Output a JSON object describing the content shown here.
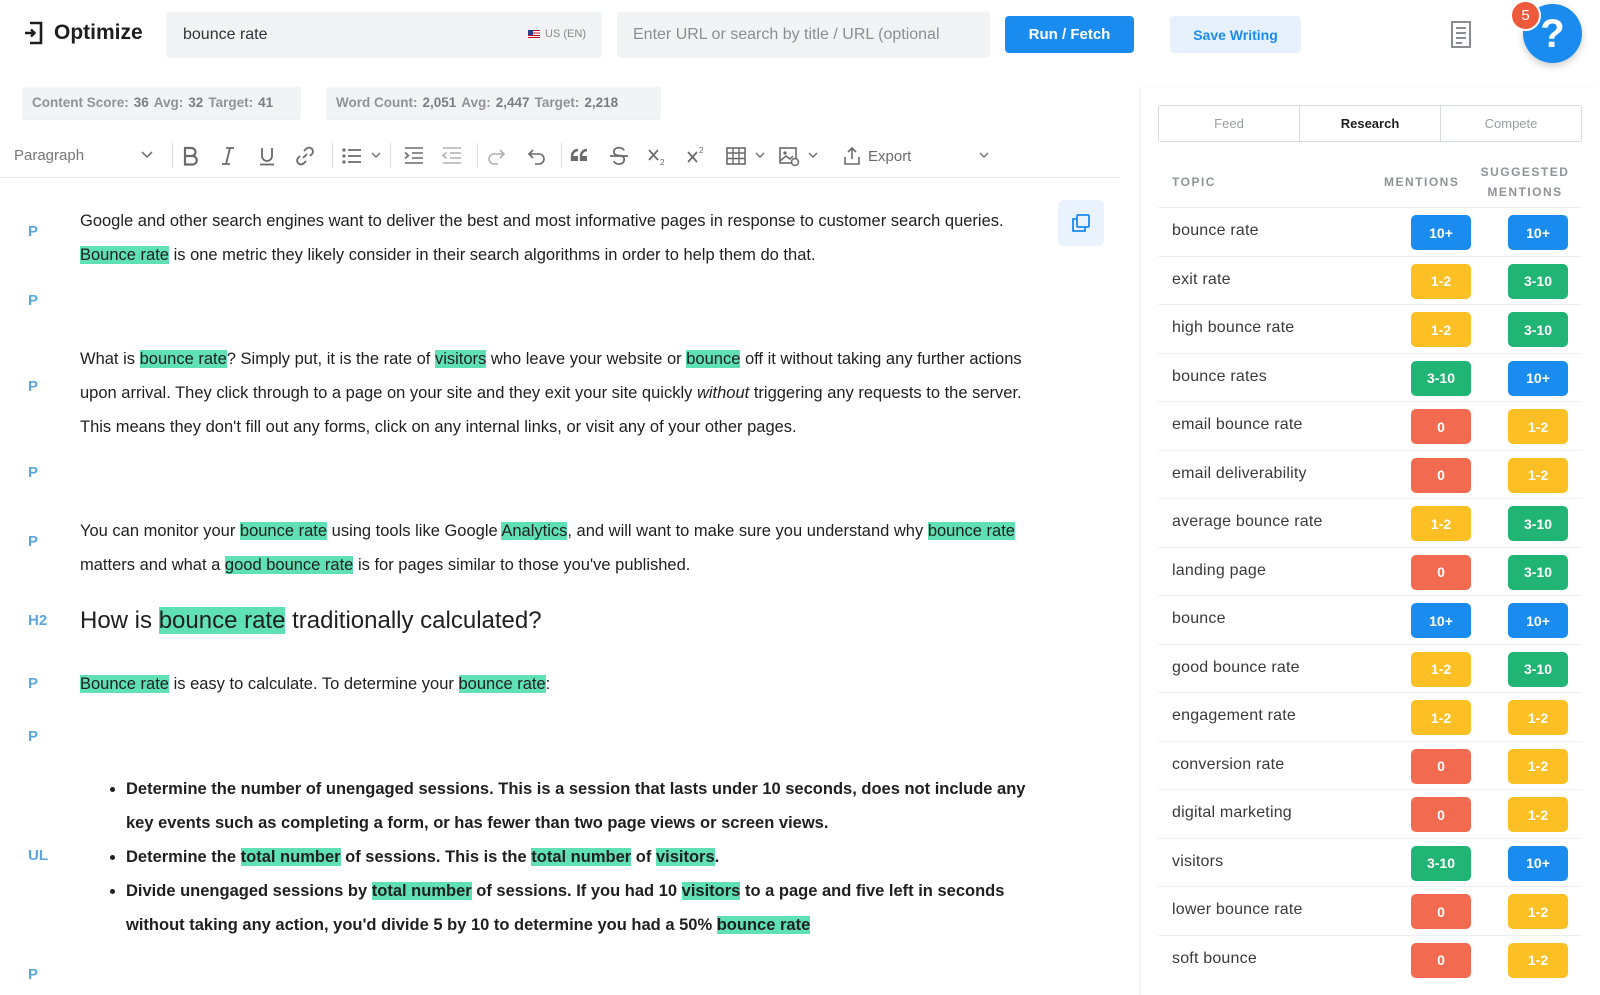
{
  "header": {
    "brand": "Optimize",
    "keyword": "bounce rate",
    "locale": "US (EN)",
    "url_placeholder": "Enter URL or search by title / URL (optional",
    "run_label": "Run / Fetch",
    "save_label": "Save Writing",
    "help_badge": "5",
    "help_symbol": "?"
  },
  "stats": {
    "score_label": "Content Score:",
    "score": "36",
    "score_avg_label": "Avg:",
    "score_avg": "32",
    "score_target_label": "Target:",
    "score_target": "41",
    "words_label": "Word Count:",
    "words": "2,051",
    "words_avg_label": "Avg:",
    "words_avg": "2,447",
    "words_target_label": "Target:",
    "words_target": "2,218"
  },
  "toolbar": {
    "paragraph": "Paragraph",
    "export": "Export"
  },
  "editor": {
    "tags": [
      "P",
      "P",
      "P",
      "P",
      "P",
      "H2",
      "P",
      "P",
      "UL",
      "P"
    ],
    "p1": [
      "Google and other search engines want to deliver the best and most informative pages in response to customer search queries. ",
      "Bounce rate",
      " is one metric they likely consider in their search algorithms in order to help them do that."
    ],
    "p2": [
      "What is ",
      "bounce rate",
      "? Simply put, it is the rate of ",
      "visitors",
      " who leave your website or ",
      "bounce",
      " off it without taking any further actions upon arrival. They click through to a page on your site and they exit your site quickly ",
      "without",
      " triggering any requests to the server. This means they don't fill out any forms, click on any internal links, or visit any of your other pages."
    ],
    "p3": [
      "You can monitor your ",
      "bounce rate",
      " using tools like Google ",
      "Analytics",
      ", and will want to make sure you understand why ",
      "bounce rate",
      " matters and what a ",
      "good bounce rate",
      " is for pages similar to those you've published."
    ],
    "h2": [
      "How is ",
      "bounce rate",
      " traditionally calculated?"
    ],
    "p4": [
      "Bounce rate",
      " is easy to calculate. To determine your ",
      "bounce rate",
      ":"
    ],
    "li1": "Determine the number of unengaged sessions. This is a session that lasts under 10 seconds, does not include any key events such as completing a form, or has fewer than two page views or screen views.",
    "li2": [
      "Determine the ",
      "total number",
      " of sessions. This is the ",
      "total number",
      " of ",
      "visitors",
      "."
    ],
    "li3": [
      "Divide unengaged sessions by ",
      "total number",
      " of sessions. If you had 10 ",
      "visitors",
      " to a page and five left in seconds without taking any action, you'd divide 5 by 10 to determine you had a 50% ",
      "bounce rate"
    ]
  },
  "panel": {
    "tabs": [
      "Feed",
      "Research",
      "Compete"
    ],
    "active_tab": "Research",
    "col_topic": "TOPIC",
    "col_mentions": "MENTIONS",
    "col_suggested": "SUGGESTED MENTIONS",
    "colors": {
      "blue": "#1a8cf0",
      "green": "#20b574",
      "yellow": "#fcbf24",
      "red": "#f26a4f"
    },
    "rows": [
      {
        "topic": "bounce rate",
        "mentions": "10+",
        "suggested": "10+"
      },
      {
        "topic": "exit rate",
        "mentions": "1-2",
        "suggested": "3-10"
      },
      {
        "topic": "high bounce rate",
        "mentions": "1-2",
        "suggested": "3-10"
      },
      {
        "topic": "bounce rates",
        "mentions": "3-10",
        "suggested": "10+"
      },
      {
        "topic": "email bounce rate",
        "mentions": "0",
        "suggested": "1-2"
      },
      {
        "topic": "email deliverability",
        "mentions": "0",
        "suggested": "1-2"
      },
      {
        "topic": "average bounce rate",
        "mentions": "1-2",
        "suggested": "3-10"
      },
      {
        "topic": "landing page",
        "mentions": "0",
        "suggested": "3-10"
      },
      {
        "topic": "bounce",
        "mentions": "10+",
        "suggested": "10+"
      },
      {
        "topic": "good bounce rate",
        "mentions": "1-2",
        "suggested": "3-10"
      },
      {
        "topic": "engagement rate",
        "mentions": "1-2",
        "suggested": "1-2"
      },
      {
        "topic": "conversion rate",
        "mentions": "0",
        "suggested": "1-2"
      },
      {
        "topic": "digital marketing",
        "mentions": "0",
        "suggested": "1-2"
      },
      {
        "topic": "visitors",
        "mentions": "3-10",
        "suggested": "10+"
      },
      {
        "topic": "lower bounce rate",
        "mentions": "0",
        "suggested": "1-2"
      },
      {
        "topic": "soft bounce",
        "mentions": "0",
        "suggested": "1-2"
      }
    ]
  }
}
